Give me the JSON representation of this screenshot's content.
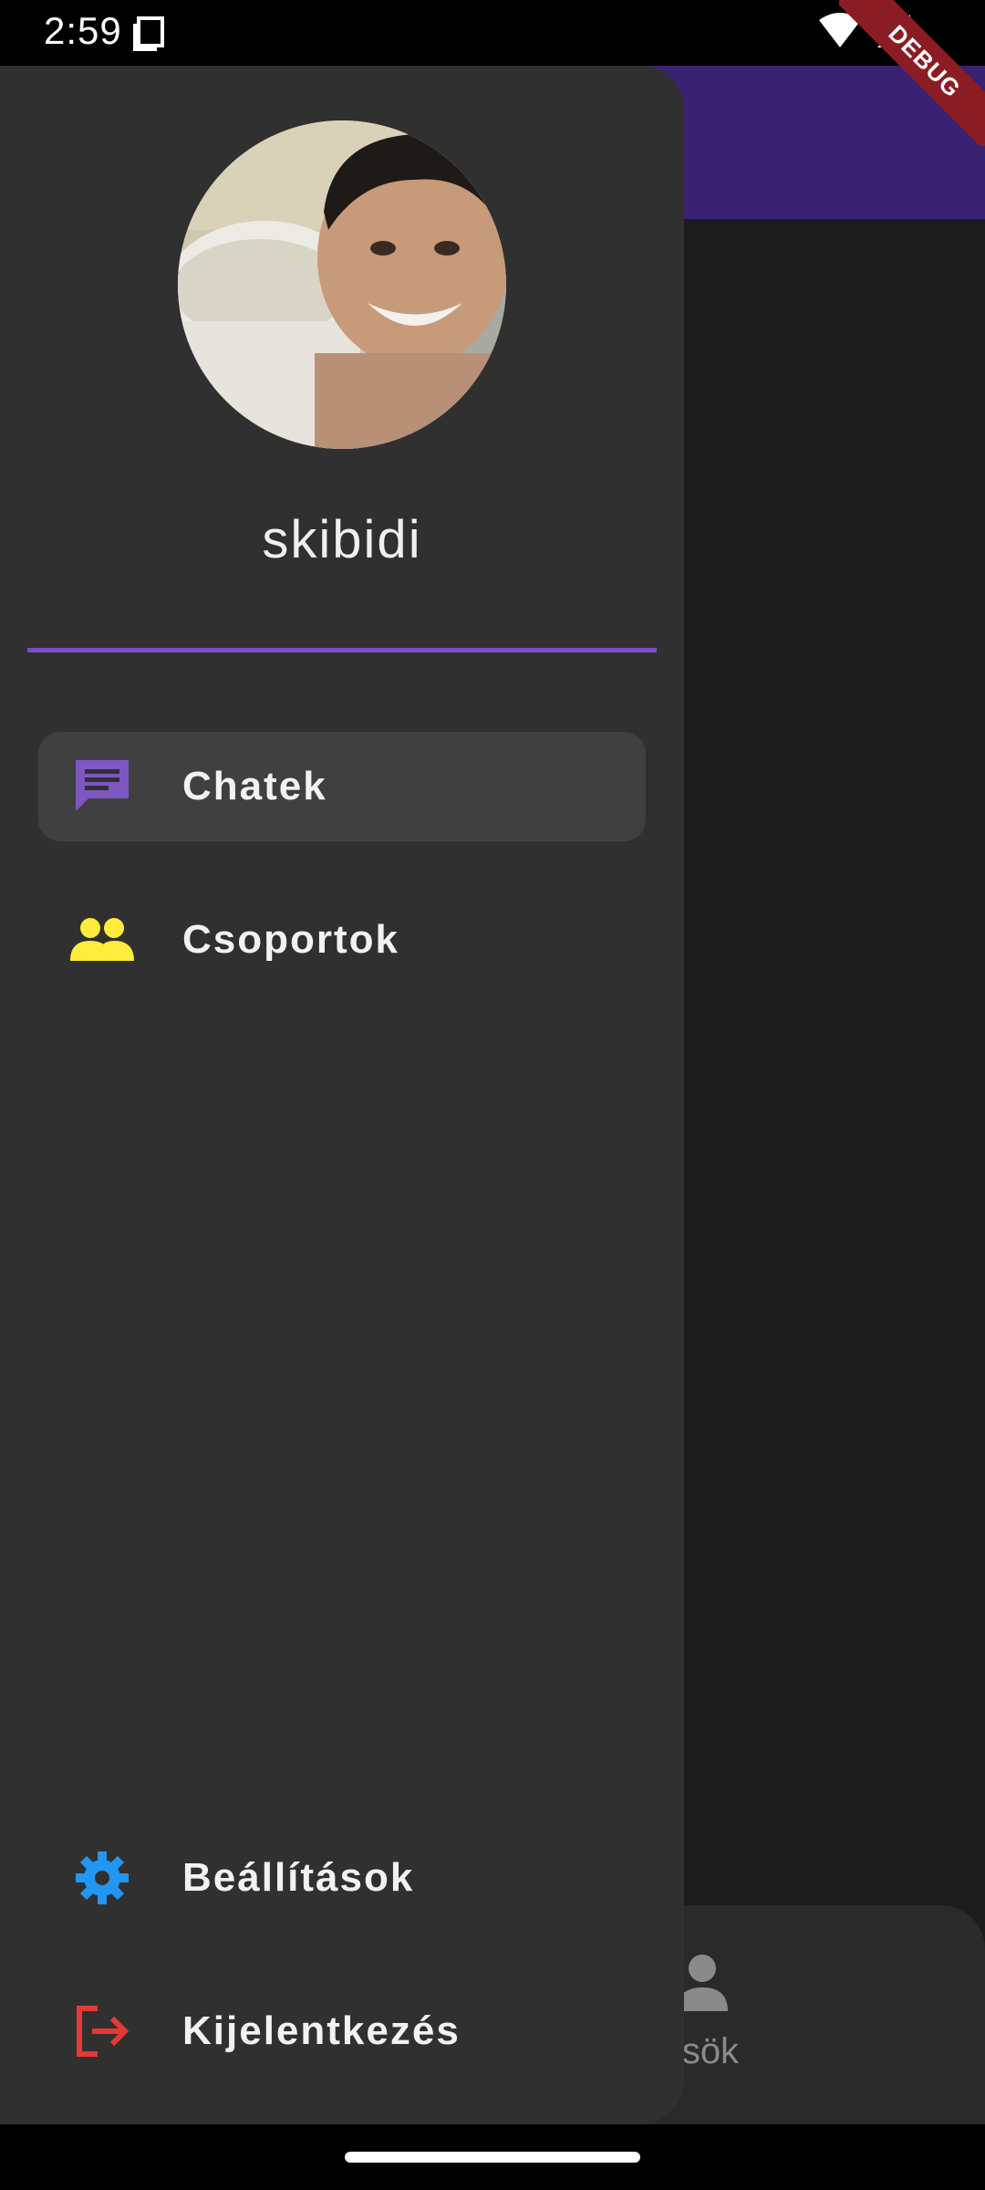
{
  "status_bar": {
    "time": "2:59",
    "icons": [
      "screenshot-icon",
      "wifi-icon",
      "signal-icon"
    ]
  },
  "debug_banner": {
    "label": "DEBUG"
  },
  "colors": {
    "app_bar": "#3a2273",
    "accent_divider": "#7b4fc9",
    "chat_icon": "#7e57c2",
    "groups_icon": "#ffeb3b",
    "settings_icon": "#2196f3",
    "logout_icon": "#e53935"
  },
  "drawer": {
    "username": "skibidi",
    "items": [
      {
        "label": "Chatek",
        "icon": "chat-icon",
        "selected": true
      },
      {
        "label": "Csoportok",
        "icon": "groups-icon",
        "selected": false
      }
    ],
    "bottom_items": [
      {
        "label": "Beállítások",
        "icon": "settings-icon"
      },
      {
        "label": "Kijelentkezés",
        "icon": "logout-icon"
      }
    ]
  },
  "background_app": {
    "bottom_nav_partial_label": "erősök",
    "bottom_nav_icon": "person-icon"
  }
}
